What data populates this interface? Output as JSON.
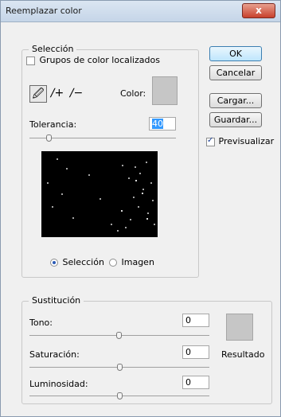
{
  "window": {
    "title": "Reemplazar color",
    "close_glyph": "x"
  },
  "selection_group": {
    "legend": "Selección",
    "localized_color_groups_label": "Grupos de color localizados",
    "localized_color_groups_checked": false,
    "tools": [
      "eyedropper-icon",
      "eyedropper-plus-icon",
      "eyedropper-minus-icon"
    ],
    "color_label": "Color:",
    "color_value": "#c6c6c6",
    "tolerance_label": "Tolerancia:",
    "tolerance_value": "40",
    "preview_mode": {
      "selection_label": "Selección",
      "image_label": "Imagen",
      "selected": "Selección"
    }
  },
  "buttons": {
    "ok": "OK",
    "cancel": "Cancelar",
    "load": "Cargar...",
    "save": "Guardar..."
  },
  "preview_checkbox": {
    "label": "Previsualizar",
    "checked": true
  },
  "replacement_group": {
    "legend": "Sustitución",
    "hue_label": "Tono:",
    "hue_value": "0",
    "saturation_label": "Saturación:",
    "saturation_value": "0",
    "lightness_label": "Luminosidad:",
    "lightness_value": "0",
    "result_label": "Resultado",
    "result_color": "#c6c6c6"
  }
}
